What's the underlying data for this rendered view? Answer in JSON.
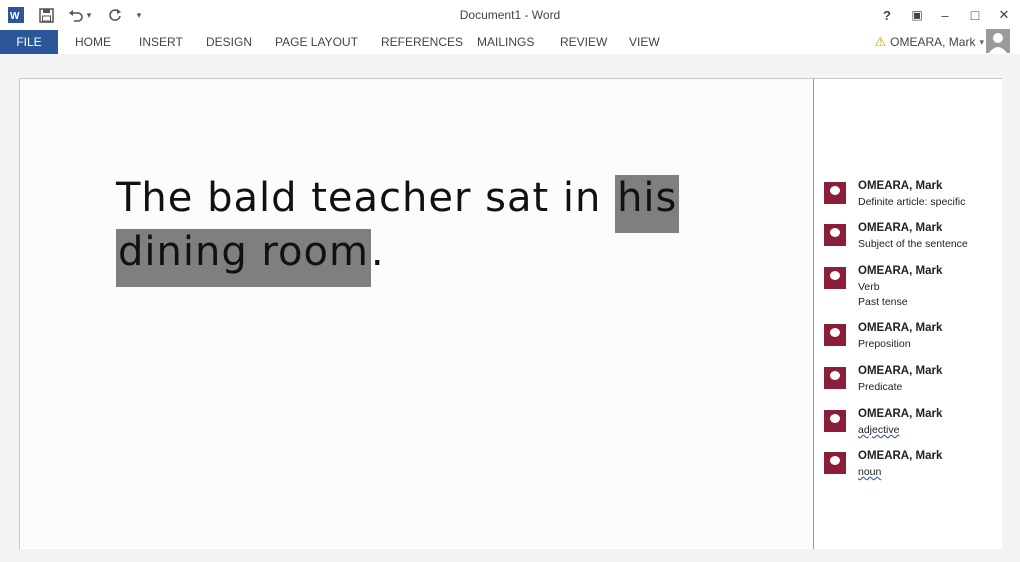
{
  "window": {
    "title": "Document1 - Word"
  },
  "quick_access": {
    "customize": "▾"
  },
  "window_controls": {
    "help": "?",
    "ribbon_display": "▣",
    "minimize": "–",
    "maximize": "□",
    "close": "✕"
  },
  "ribbon": {
    "tabs": [
      "FILE",
      "HOME",
      "INSERT",
      "DESIGN",
      "PAGE LAYOUT",
      "REFERENCES",
      "MAILINGS",
      "REVIEW",
      "VIEW"
    ],
    "user_name": "OMEARA, Mark",
    "user_dropdown": "▾",
    "warning_icon": "⚠"
  },
  "document": {
    "line1_text": "The bald teacher sat in ",
    "line1_highlight": "his",
    "line2_highlight": "dining room",
    "line2_end": "."
  },
  "comments": [
    {
      "author": "OMEARA, Mark",
      "text": "Definite article: specific",
      "spellcheck": false
    },
    {
      "author": "OMEARA, Mark",
      "text": "Subject of the sentence",
      "spellcheck": false
    },
    {
      "author": "OMEARA, Mark",
      "text": "Verb\nPast tense",
      "spellcheck": false
    },
    {
      "author": "OMEARA, Mark",
      "text": "Preposition",
      "spellcheck": false
    },
    {
      "author": "OMEARA, Mark",
      "text": "Predicate",
      "spellcheck": false
    },
    {
      "author": "OMEARA, Mark",
      "text": "adjective",
      "spellcheck": true
    },
    {
      "author": "OMEARA, Mark",
      "text": "noun",
      "spellcheck": true
    }
  ],
  "colors": {
    "file_tab": "#2b579a",
    "comment_avatar": "#8b1f3a",
    "highlight": "#7f7f7f"
  }
}
